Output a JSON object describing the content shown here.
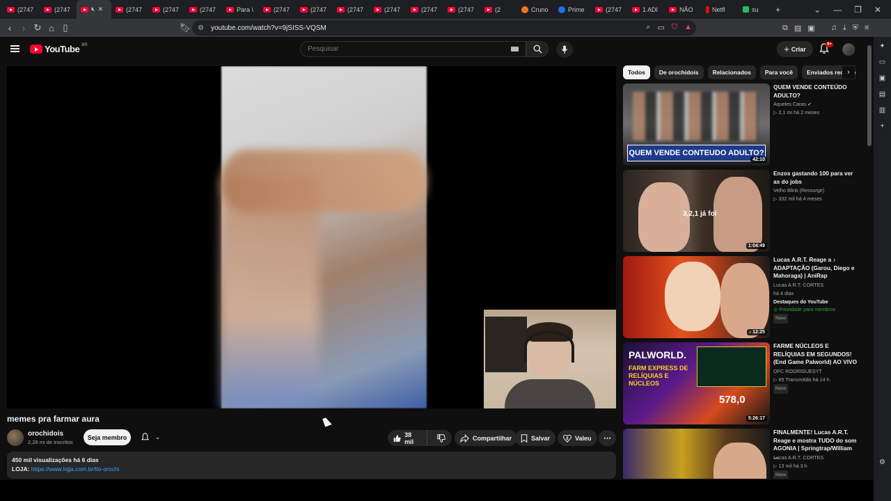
{
  "browser": {
    "tabs": [
      {
        "label": "(2747",
        "icon": "youtube-icon"
      },
      {
        "label": "(2747",
        "icon": "youtube-icon"
      },
      {
        "label": "",
        "icon": "youtube-icon",
        "active": true,
        "muted": true
      },
      {
        "label": "(2747",
        "icon": "youtube-icon"
      },
      {
        "label": "(2747",
        "icon": "youtube-icon"
      },
      {
        "label": "(2747",
        "icon": "youtube-icon"
      },
      {
        "label": "Para \\",
        "icon": "youtube-icon"
      },
      {
        "label": "(2747",
        "icon": "youtube-icon"
      },
      {
        "label": "(2747",
        "icon": "youtube-icon"
      },
      {
        "label": "(2747",
        "icon": "youtube-icon"
      },
      {
        "label": "(2747",
        "icon": "youtube-icon"
      },
      {
        "label": "(2747",
        "icon": "youtube-icon"
      },
      {
        "label": "(2747",
        "icon": "youtube-icon"
      },
      {
        "label": "(2",
        "icon": "youtube-icon"
      },
      {
        "label": "Cruno",
        "icon": "crunchyroll-icon"
      },
      {
        "label": "Prime",
        "icon": "prime-icon"
      },
      {
        "label": "(2747",
        "icon": "youtube-icon"
      },
      {
        "label": "1 ADI",
        "icon": "youtube-icon"
      },
      {
        "label": "NÃO",
        "icon": "youtube-icon"
      },
      {
        "label": "Netfl",
        "icon": "netflix-icon"
      },
      {
        "label": "su",
        "icon": "green-icon"
      }
    ],
    "url": "youtube.com/watch?v=9jSISS-VQSM"
  },
  "header": {
    "logo_text": "YouTube",
    "country": "BR",
    "search_placeholder": "Pesquisar",
    "create_label": "Criar",
    "notif_count": "9+"
  },
  "video": {
    "title": "memes pra farmar aura",
    "channel": "orochidois",
    "subscribers": "2,28 mi de inscritos",
    "member_label": "Seja membro",
    "likes": "38 mil",
    "share_label": "Compartilhar",
    "save_label": "Salvar",
    "thanks_label": "Valeu",
    "views_date": "450 mil visualizações  há 6 dias",
    "store_label": "LOJA:",
    "store_link": "https://www.lojja.com.br/tio-orochi"
  },
  "chips": [
    "Todos",
    "De orochidois",
    "Relacionados",
    "Para você",
    "Enviados recentemente"
  ],
  "recommendations": [
    {
      "title": "QUEM VENDE CONTEÚDO ADULTO?",
      "channel": "Aqueles Caras",
      "meta": "2,1 mi  há 2 meses",
      "duration": "42:10",
      "thumb_text": "QUEM VENDE CONTEUDO ADULTO?"
    },
    {
      "title": "Enzos gastando 100 para ver as do jobs",
      "channel": "Velho Blink (Ressurge)",
      "meta": "332 mil  há 4 meses",
      "duration": "1:04:49",
      "thumb_text": "3,2,1 já foi"
    },
    {
      "title": "Lucas A.R.T. Reage a ♪ ADAPTAÇÃO (Garou, Diego e Mahoraga) | AniRap",
      "channel": "Lucas A.R.T. CORTES",
      "meta": "há 4 dias",
      "extra": "Destaques do YouTube",
      "priority": "Prioridade para membros",
      "tag": "Novo",
      "duration": "12:25"
    },
    {
      "title": "FARME NÚCLEOS E RELÍQUIAS EM SEGUNDOS! (End Game Palworld) AO VIVO",
      "channel": "OFC RODRIGUESYT",
      "meta": "65  Transmitido há 14 h",
      "tag": "Novo",
      "duration": "5:26:17",
      "thumb_title": "PALWORLD.",
      "thumb_sub": "FARM EXPRESS DE RELÍQUIAS E NÚCLEOS",
      "thumb_num": "578,0"
    },
    {
      "title": "FINALMENTE! Lucas A.R.T. Reage e mostra TUDO do som AGONIA | Springtrap/William ...",
      "channel": "Lucas A.R.T. CORTES",
      "meta": "13 mil  há 3 h",
      "tag": "Novo"
    }
  ]
}
